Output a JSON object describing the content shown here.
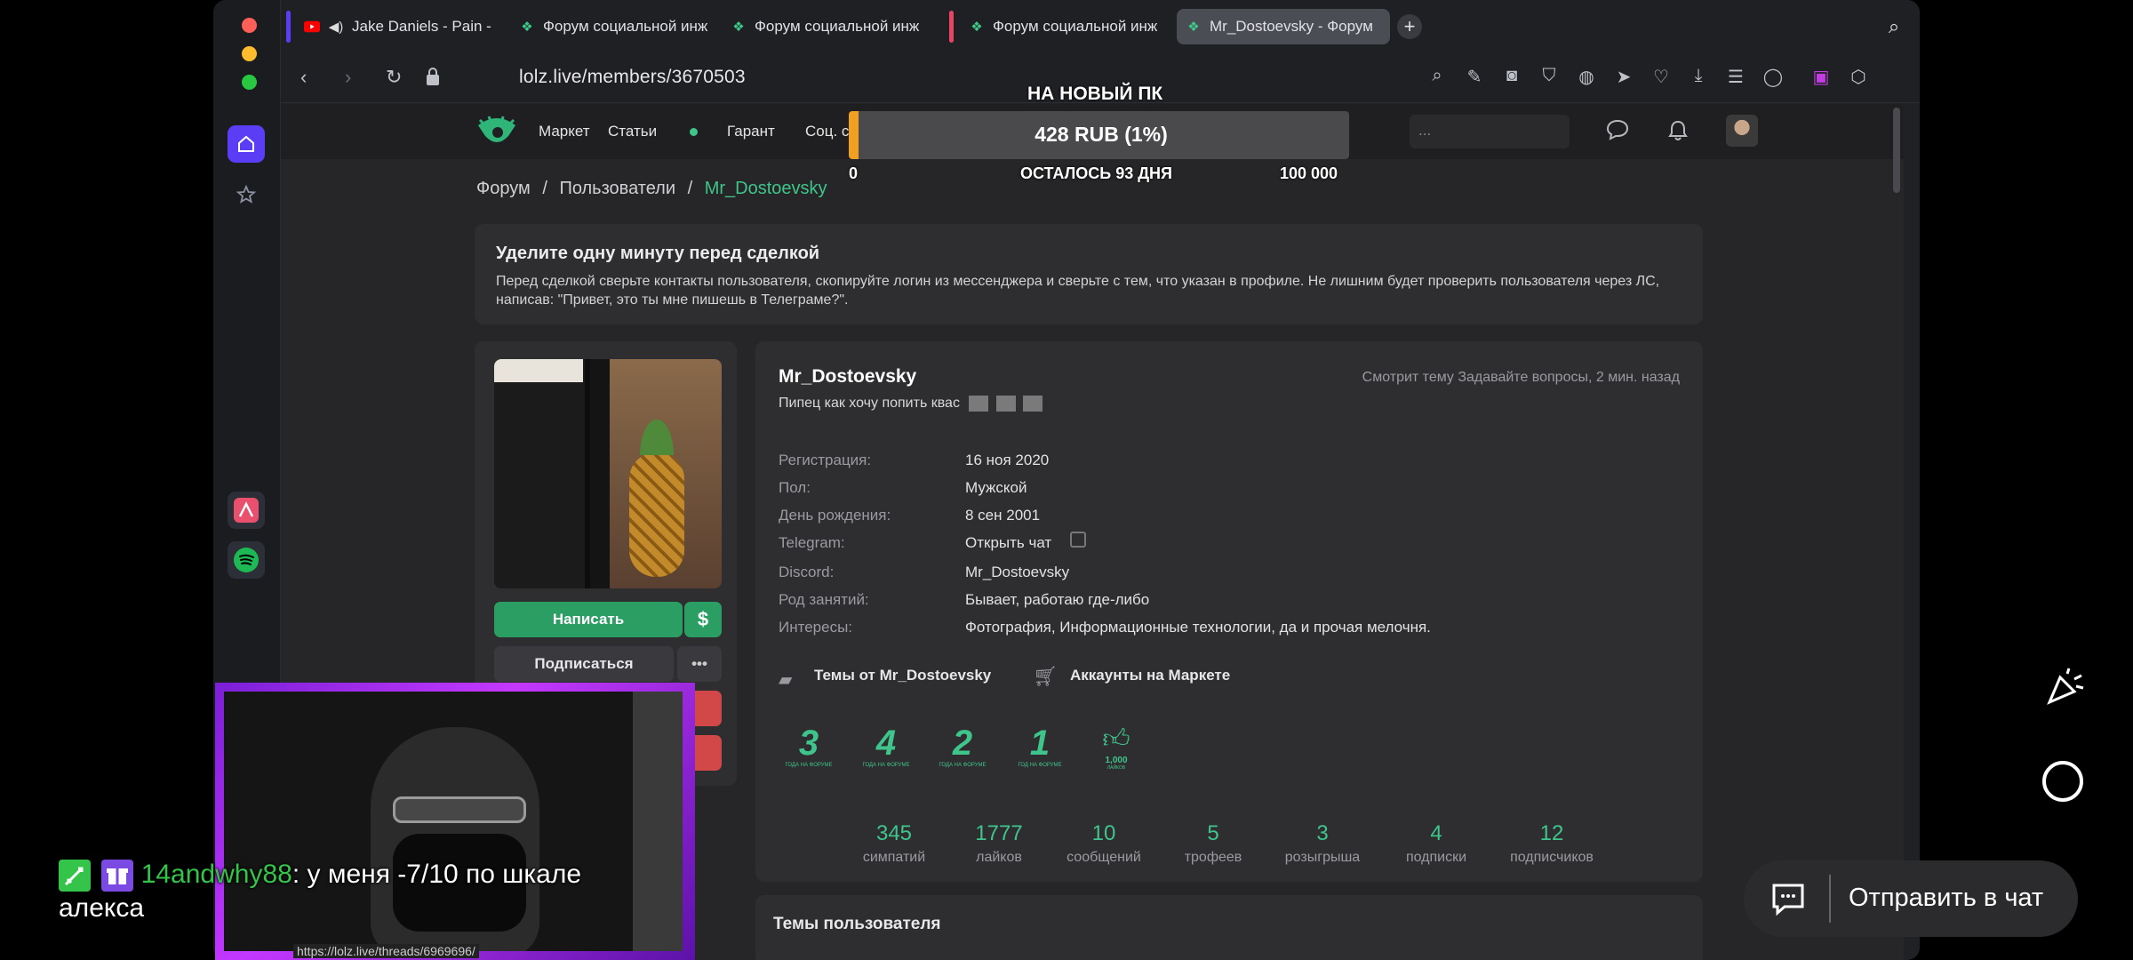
{
  "browser": {
    "tabs": [
      {
        "title": "Jake Daniels - Pain -",
        "icon": "youtube-icon"
      },
      {
        "title": "Форум социальной инж",
        "icon": "lolz-icon"
      },
      {
        "title": "Форум социальной инж",
        "icon": "lolz-icon"
      },
      {
        "title": "Форум социальной инж",
        "icon": "lolz-icon"
      },
      {
        "title": "Mr_Dostoevsky - Форум",
        "icon": "lolz-icon"
      }
    ],
    "url": "lolz.live/members/3670503"
  },
  "site": {
    "nav": [
      "Маркет",
      "Статьи",
      "Гарант",
      "Соц. с"
    ],
    "search_placeholder": "..."
  },
  "breadcrumb": {
    "forum": "Форум",
    "sep1": "/",
    "users": "Пользователи",
    "sep2": "/",
    "current": "Mr_Dostoevsky"
  },
  "warning": {
    "title": "Уделите одну минуту перед сделкой",
    "text": "Перед сделкой сверьте контакты пользователя, скопируйте логин из мессенджера и сверьте с тем, что указан в профиле. Не лишним будет проверить пользователя через ЛС, написав: \"Привет, это ты мне пишешь в Телеграме?\"."
  },
  "profile": {
    "username": "Mr_Dostoevsky",
    "status": "Пипец как хочу попить квас",
    "activity": "Смотрит тему Задавайте вопросы, 2 мин. назад",
    "write_button": "Написать",
    "dollar": "$",
    "subscribe_button": "Подписаться",
    "more": "•••",
    "info": [
      {
        "label": "Регистрация:",
        "value": "16 ноя 2020"
      },
      {
        "label": "Пол:",
        "value": "Мужской"
      },
      {
        "label": "День рождения:",
        "value": "8 сен 2001"
      },
      {
        "label": "Telegram:",
        "value": "Открыть чат"
      },
      {
        "label": "Discord:",
        "value": "Mr_Dostoevsky"
      },
      {
        "label": "Род занятий:",
        "value": "Бывает, работаю где-либо"
      },
      {
        "label": "Интересы:",
        "value": "Фотография, Информационные технологии, да и прочая мелочня."
      }
    ],
    "links": {
      "topics": "Темы от Mr_Dostoevsky",
      "market": "Аккаунты на Маркете"
    },
    "trophies": [
      {
        "num": "3",
        "text": "ГОДА НА ФОРУМЕ"
      },
      {
        "num": "4",
        "text": "ГОДА НА ФОРУМЕ"
      },
      {
        "num": "2",
        "text": "ГОДА НА ФОРУМЕ"
      },
      {
        "num": "1",
        "text": "ГОД НА ФОРУМЕ"
      },
      {
        "num": "1,000",
        "text": "ЛАЙКОВ"
      }
    ],
    "stats": [
      {
        "value": "345",
        "label": "симпатий"
      },
      {
        "value": "1777",
        "label": "лайков"
      },
      {
        "value": "10",
        "label": "сообщений"
      },
      {
        "value": "5",
        "label": "трофеев"
      },
      {
        "value": "3",
        "label": "розыгрыша"
      },
      {
        "value": "4",
        "label": "подписки"
      },
      {
        "value": "12",
        "label": "подписчиков"
      }
    ]
  },
  "user_topics_title": "Темы пользователя",
  "donation": {
    "header": "НА НОВЫЙ ПК",
    "amount": "428 RUB (1%)",
    "min": "0",
    "remaining": "ОСТАЛОСЬ 93 ДНЯ",
    "max": "100 000",
    "progress": 0.01
  },
  "chat": {
    "username": "14andwhy88",
    "message": ": у меня -7/10 по шкале алекса"
  },
  "stream": {
    "send_to_chat": "Отправить в чат",
    "partial_url": "https://lolz.live/threads/6969696/"
  },
  "colors": {
    "accent": "#3fc58c",
    "button_green": "#2b9e64",
    "red_button": "#d24848",
    "webcam_frame": "#a024e8"
  }
}
